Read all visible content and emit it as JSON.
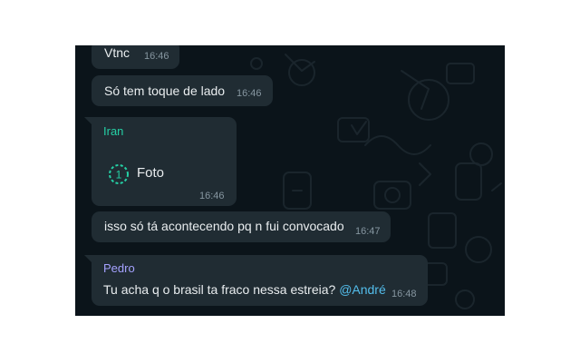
{
  "messages": [
    {
      "text": "Vtnc",
      "time": "16:46"
    },
    {
      "text": "Só tem toque de lado",
      "time": "16:46"
    },
    {
      "sender": "Iran",
      "sender_color": "#25d0a5",
      "media_count": "1",
      "media_label": "Foto",
      "time": "16:46"
    },
    {
      "text": "isso só tá acontecendo pq n fui convocado",
      "time": "16:47"
    },
    {
      "sender": "Pedro",
      "sender_color": "#a5a2ff",
      "text": "Tu acha q o brasil ta fraco nessa estreia?",
      "mention": "@André",
      "time": "16:48"
    }
  ],
  "colors": {
    "chat_background": "#0b141a",
    "bubble": "#202c33",
    "text": "#e9edef",
    "timestamp": "#8696a0",
    "mention": "#53bdeb",
    "view_once_accent": "#25d0a5"
  },
  "icons": [
    "view-once-icon"
  ]
}
